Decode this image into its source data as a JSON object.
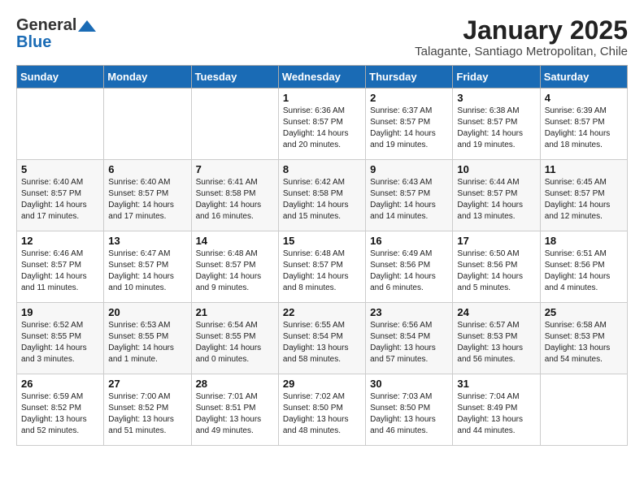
{
  "header": {
    "logo_general": "General",
    "logo_blue": "Blue",
    "month_title": "January 2025",
    "subtitle": "Talagante, Santiago Metropolitan, Chile"
  },
  "days_of_week": [
    "Sunday",
    "Monday",
    "Tuesday",
    "Wednesday",
    "Thursday",
    "Friday",
    "Saturday"
  ],
  "weeks": [
    [
      {
        "day": "",
        "info": ""
      },
      {
        "day": "",
        "info": ""
      },
      {
        "day": "",
        "info": ""
      },
      {
        "day": "1",
        "info": "Sunrise: 6:36 AM\nSunset: 8:57 PM\nDaylight: 14 hours\nand 20 minutes."
      },
      {
        "day": "2",
        "info": "Sunrise: 6:37 AM\nSunset: 8:57 PM\nDaylight: 14 hours\nand 19 minutes."
      },
      {
        "day": "3",
        "info": "Sunrise: 6:38 AM\nSunset: 8:57 PM\nDaylight: 14 hours\nand 19 minutes."
      },
      {
        "day": "4",
        "info": "Sunrise: 6:39 AM\nSunset: 8:57 PM\nDaylight: 14 hours\nand 18 minutes."
      }
    ],
    [
      {
        "day": "5",
        "info": "Sunrise: 6:40 AM\nSunset: 8:57 PM\nDaylight: 14 hours\nand 17 minutes."
      },
      {
        "day": "6",
        "info": "Sunrise: 6:40 AM\nSunset: 8:57 PM\nDaylight: 14 hours\nand 17 minutes."
      },
      {
        "day": "7",
        "info": "Sunrise: 6:41 AM\nSunset: 8:58 PM\nDaylight: 14 hours\nand 16 minutes."
      },
      {
        "day": "8",
        "info": "Sunrise: 6:42 AM\nSunset: 8:58 PM\nDaylight: 14 hours\nand 15 minutes."
      },
      {
        "day": "9",
        "info": "Sunrise: 6:43 AM\nSunset: 8:57 PM\nDaylight: 14 hours\nand 14 minutes."
      },
      {
        "day": "10",
        "info": "Sunrise: 6:44 AM\nSunset: 8:57 PM\nDaylight: 14 hours\nand 13 minutes."
      },
      {
        "day": "11",
        "info": "Sunrise: 6:45 AM\nSunset: 8:57 PM\nDaylight: 14 hours\nand 12 minutes."
      }
    ],
    [
      {
        "day": "12",
        "info": "Sunrise: 6:46 AM\nSunset: 8:57 PM\nDaylight: 14 hours\nand 11 minutes."
      },
      {
        "day": "13",
        "info": "Sunrise: 6:47 AM\nSunset: 8:57 PM\nDaylight: 14 hours\nand 10 minutes."
      },
      {
        "day": "14",
        "info": "Sunrise: 6:48 AM\nSunset: 8:57 PM\nDaylight: 14 hours\nand 9 minutes."
      },
      {
        "day": "15",
        "info": "Sunrise: 6:48 AM\nSunset: 8:57 PM\nDaylight: 14 hours\nand 8 minutes."
      },
      {
        "day": "16",
        "info": "Sunrise: 6:49 AM\nSunset: 8:56 PM\nDaylight: 14 hours\nand 6 minutes."
      },
      {
        "day": "17",
        "info": "Sunrise: 6:50 AM\nSunset: 8:56 PM\nDaylight: 14 hours\nand 5 minutes."
      },
      {
        "day": "18",
        "info": "Sunrise: 6:51 AM\nSunset: 8:56 PM\nDaylight: 14 hours\nand 4 minutes."
      }
    ],
    [
      {
        "day": "19",
        "info": "Sunrise: 6:52 AM\nSunset: 8:55 PM\nDaylight: 14 hours\nand 3 minutes."
      },
      {
        "day": "20",
        "info": "Sunrise: 6:53 AM\nSunset: 8:55 PM\nDaylight: 14 hours\nand 1 minute."
      },
      {
        "day": "21",
        "info": "Sunrise: 6:54 AM\nSunset: 8:55 PM\nDaylight: 14 hours\nand 0 minutes."
      },
      {
        "day": "22",
        "info": "Sunrise: 6:55 AM\nSunset: 8:54 PM\nDaylight: 13 hours\nand 58 minutes."
      },
      {
        "day": "23",
        "info": "Sunrise: 6:56 AM\nSunset: 8:54 PM\nDaylight: 13 hours\nand 57 minutes."
      },
      {
        "day": "24",
        "info": "Sunrise: 6:57 AM\nSunset: 8:53 PM\nDaylight: 13 hours\nand 56 minutes."
      },
      {
        "day": "25",
        "info": "Sunrise: 6:58 AM\nSunset: 8:53 PM\nDaylight: 13 hours\nand 54 minutes."
      }
    ],
    [
      {
        "day": "26",
        "info": "Sunrise: 6:59 AM\nSunset: 8:52 PM\nDaylight: 13 hours\nand 52 minutes."
      },
      {
        "day": "27",
        "info": "Sunrise: 7:00 AM\nSunset: 8:52 PM\nDaylight: 13 hours\nand 51 minutes."
      },
      {
        "day": "28",
        "info": "Sunrise: 7:01 AM\nSunset: 8:51 PM\nDaylight: 13 hours\nand 49 minutes."
      },
      {
        "day": "29",
        "info": "Sunrise: 7:02 AM\nSunset: 8:50 PM\nDaylight: 13 hours\nand 48 minutes."
      },
      {
        "day": "30",
        "info": "Sunrise: 7:03 AM\nSunset: 8:50 PM\nDaylight: 13 hours\nand 46 minutes."
      },
      {
        "day": "31",
        "info": "Sunrise: 7:04 AM\nSunset: 8:49 PM\nDaylight: 13 hours\nand 44 minutes."
      },
      {
        "day": "",
        "info": ""
      }
    ]
  ]
}
